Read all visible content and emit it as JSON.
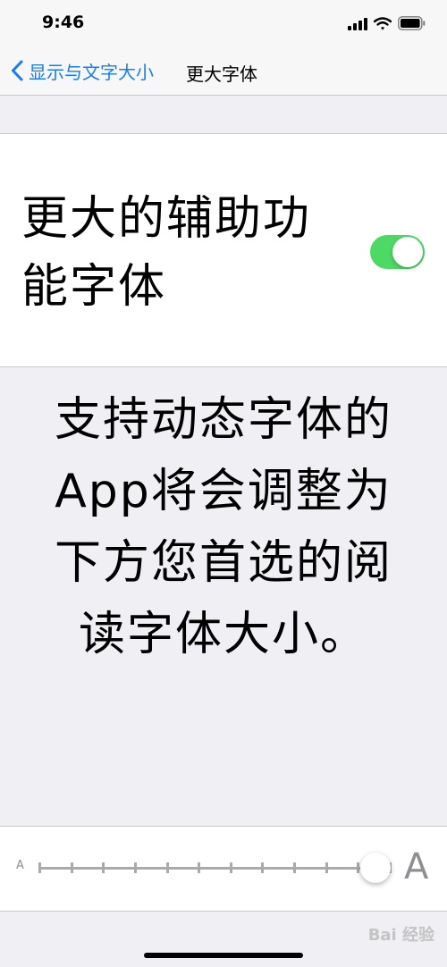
{
  "status_bar": {
    "time": "9:46",
    "icons": [
      "signal-icon",
      "wifi-icon",
      "battery-icon"
    ]
  },
  "nav": {
    "back_label": "显示与文字大小",
    "title": "更大字体",
    "accent": "#1a7cf5"
  },
  "toggle": {
    "label": "更大的辅助功能字体",
    "on": true,
    "on_color": "#4cd964"
  },
  "description": "支持动态字体的App将会调整为下方您首选的阅读字体大小。",
  "slider": {
    "min_label": "A",
    "max_label": "A",
    "steps": 12,
    "value_fraction": 1.0
  },
  "watermark": "Bai 经验"
}
